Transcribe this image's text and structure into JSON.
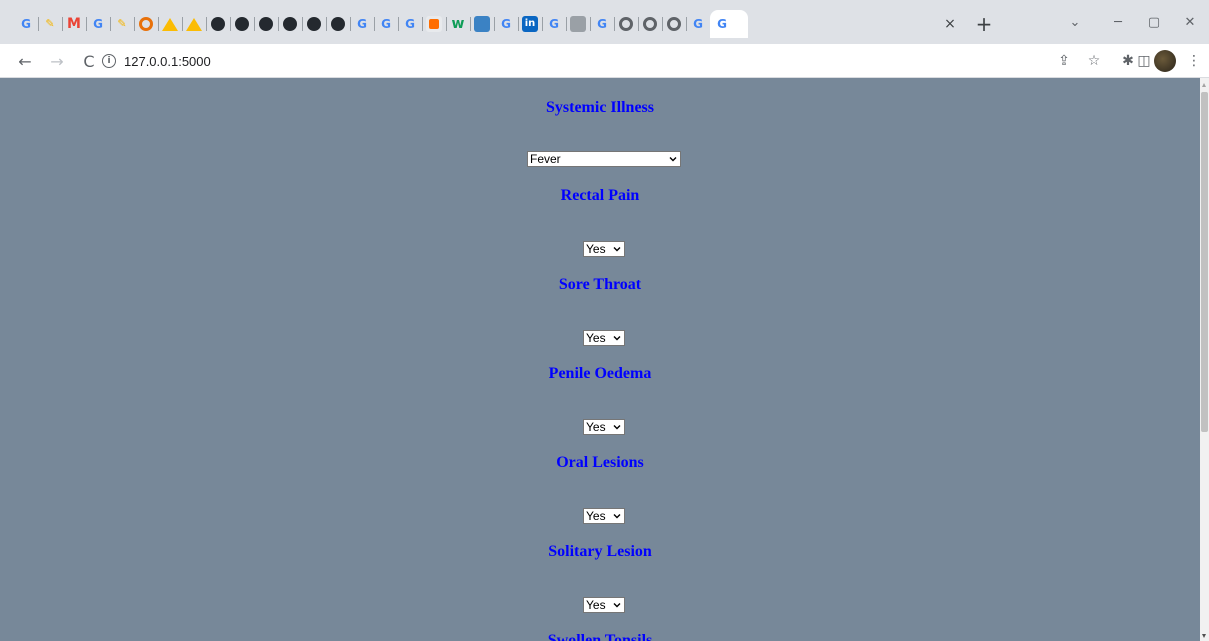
{
  "browser": {
    "tab_favicons": [
      "google",
      "learning",
      "gmail",
      "google",
      "learning",
      "certificate",
      "drive",
      "drive",
      "github",
      "github",
      "github",
      "github",
      "github",
      "github",
      "google",
      "google",
      "google",
      "bar-app",
      "word-app",
      "image-app",
      "google",
      "linkedin",
      "google",
      "gray-app",
      "google",
      "chrome",
      "chrome",
      "chrome",
      "google",
      "google"
    ],
    "active_tab_favicon": "google",
    "close_tab_glyph": "×",
    "new_tab_glyph": "+",
    "url": "127.0.0.1:5000"
  },
  "page": {
    "background_color": "#778899",
    "heading_color": "#0000ff",
    "fields": [
      {
        "label": "Systemic Illness",
        "value": "Fever"
      },
      {
        "label": "Rectal Pain",
        "value": "Yes"
      },
      {
        "label": "Sore Throat",
        "value": "Yes"
      },
      {
        "label": "Penile Oedema",
        "value": "Yes"
      },
      {
        "label": "Oral Lesions",
        "value": "Yes"
      },
      {
        "label": "Solitary Lesion",
        "value": "Yes"
      }
    ],
    "partial_next_label": "Swollen Tonsils"
  }
}
